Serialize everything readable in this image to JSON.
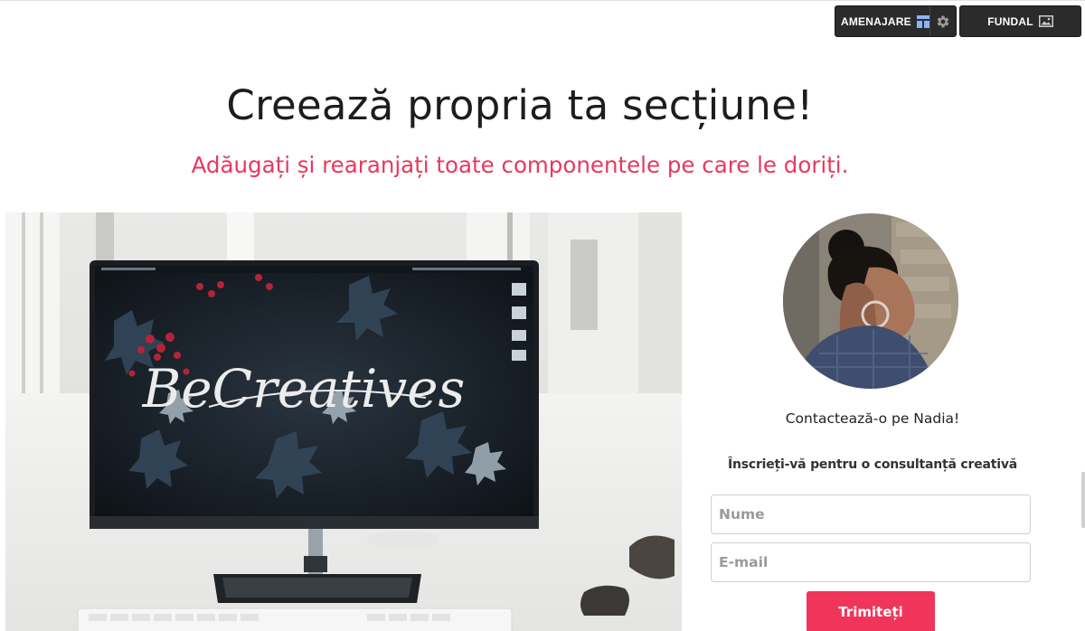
{
  "toolbar": {
    "layout_label": "AMENAJARE",
    "layout_icon": "layout-icon",
    "settings_icon": "gear-icon",
    "background_label": "FUNDAL",
    "background_icon": "image-icon"
  },
  "section": {
    "title": "Creează propria ta secțiune!",
    "subtitle": "Adăugați și rearanjați toate componentele pe care le doriți."
  },
  "hero": {
    "screen_text": "BeCreatives"
  },
  "contact": {
    "title": "Contactează-o pe Nadia!",
    "signup_text": "Înscrieți-vă pentru o consultanță creativă",
    "name_placeholder": "Nume",
    "email_placeholder": "E-mail",
    "submit_label": "Trimiteți"
  },
  "colors": {
    "accent": "#f0345a",
    "subtitle": "#e8385f",
    "toolbar_bg": "#2b2b2b",
    "layout_icon": "#8ab4f8"
  }
}
